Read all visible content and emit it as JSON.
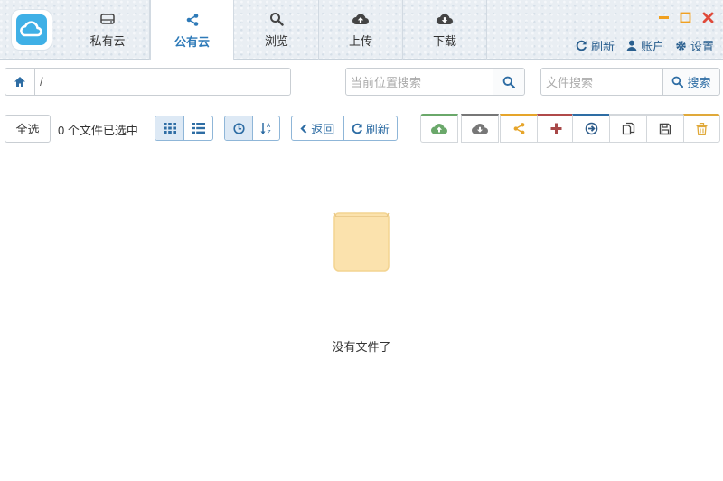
{
  "header": {
    "tabs": [
      {
        "label": "私有云",
        "icon": "hard-drive-icon"
      },
      {
        "label": "公有云",
        "icon": "share-icon",
        "active": true
      },
      {
        "label": "浏览",
        "icon": "search-icon"
      },
      {
        "label": "上传",
        "icon": "cloud-upload-icon"
      },
      {
        "label": "下载",
        "icon": "cloud-download-icon"
      }
    ],
    "links": {
      "refresh": "刷新",
      "account": "账户",
      "settings": "设置"
    }
  },
  "addressbar": {
    "path": "/",
    "location_search_placeholder": "当前位置搜索",
    "file_search_placeholder": "文件搜索",
    "search_label": "搜索"
  },
  "toolbar": {
    "select_all": "全选",
    "selected_info": "0 个文件已选中",
    "back_label": "返回",
    "refresh_label": "刷新"
  },
  "empty": {
    "message": "没有文件了"
  },
  "colors": {
    "accent": "#2e7ab8",
    "upload": "#6aa86a",
    "download": "#777777",
    "share": "#e6a52a",
    "add": "#b04a4a",
    "move": "#2e6da4",
    "delete": "#e0a93a",
    "close": "#e04a3a",
    "minimize": "#f0a020",
    "empty_box": "#fbe2ad"
  }
}
